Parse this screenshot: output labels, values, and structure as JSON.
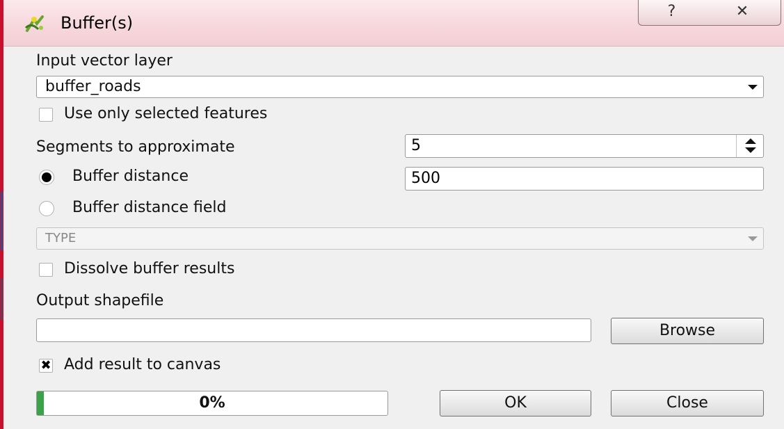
{
  "window": {
    "title": "Buffer(s)",
    "help_button": "?",
    "close_button": "✕",
    "app_icon": "qgis-buffer-icon"
  },
  "input_layer": {
    "label": "Input vector layer",
    "value": "buffer_roads"
  },
  "use_selected": {
    "label": "Use only selected features",
    "checked": false
  },
  "segments": {
    "label": "Segments to approximate",
    "value": "5"
  },
  "buffer_distance": {
    "label": "Buffer distance",
    "selected": true,
    "value": "500"
  },
  "buffer_distance_field": {
    "label": "Buffer distance field",
    "selected": false,
    "value": "TYPE"
  },
  "dissolve": {
    "label": "Dissolve buffer results",
    "checked": false
  },
  "output": {
    "label": "Output shapefile",
    "value": "",
    "browse_label": "Browse"
  },
  "add_to_canvas": {
    "label": "Add result to canvas",
    "checked": true,
    "check_glyph": "✖"
  },
  "progress": {
    "fraction": 0.02,
    "text": "0%"
  },
  "buttons": {
    "ok_label": "OK",
    "close_label": "Close"
  },
  "colors": {
    "titlebar": "#f6d7dc",
    "window_border": "#c8102e",
    "progress_fill": "#3aa34a"
  }
}
